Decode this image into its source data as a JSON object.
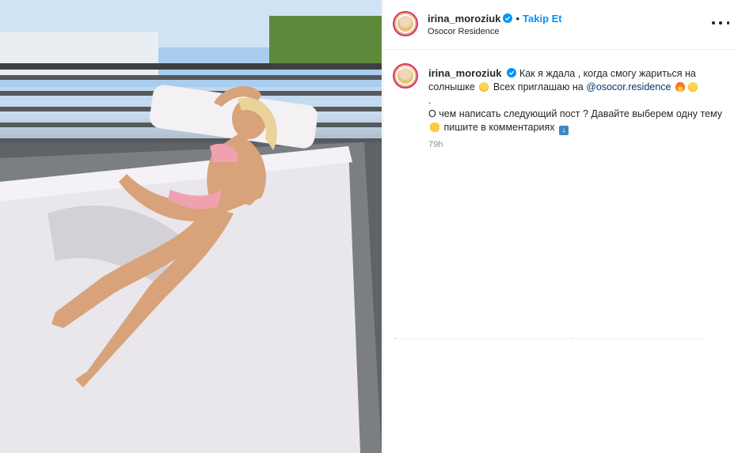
{
  "photo": {
    "alt": "",
    "colors": {
      "sky": "#9ec5e8",
      "mattress": "#e9e6ec",
      "deck": "#6b6f74"
    }
  },
  "header": {
    "username": "irina_moroziuk",
    "separator": "•",
    "follow_label": "Takip Et",
    "location": "Osocor Residence",
    "more_icon": "more-horizontal-icon"
  },
  "comment": {
    "username": "irina_moroziuk",
    "line1": "Как я ждала , когда смогу жариться на солнышке",
    "line2_pre": "Всех приглашаю на",
    "mention": "@osocor.residence",
    "line3": ".",
    "line4": "О чем написать следующий пост ? Давайте выберем одну тему",
    "line5": "пишите в комментариях",
    "time": "79h"
  },
  "colors": {
    "accent": "#0095f6",
    "verified": "#0095f6",
    "ring": "#e1306c",
    "mention": "#00376b"
  }
}
